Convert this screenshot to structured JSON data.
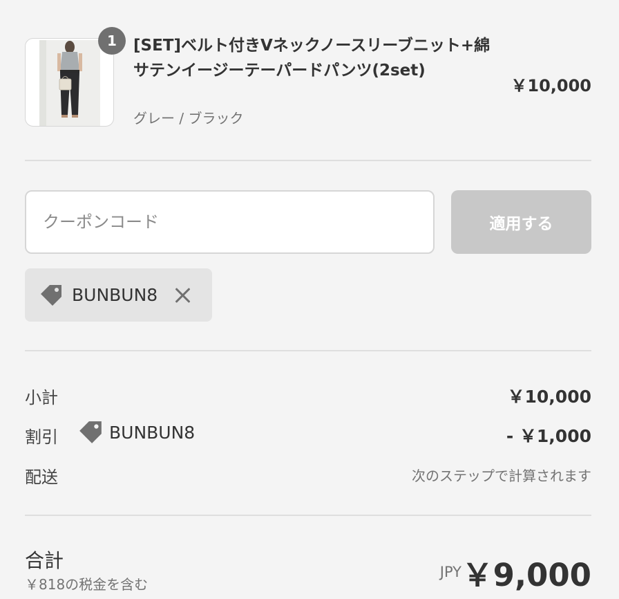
{
  "product": {
    "quantity_badge": "1",
    "title": "[SET]ベルト付きVネックノースリーブニット+綿サテンイージーテーパードパンツ(2set)",
    "variant": "グレー / ブラック",
    "price": "￥10,000"
  },
  "coupon": {
    "placeholder": "クーポンコード",
    "apply_label": "適用する",
    "applied_code": "BUNBUN8"
  },
  "summary": {
    "subtotal_label": "小計",
    "subtotal_value": "￥10,000",
    "discount_label": "割引",
    "discount_code": "BUNBUN8",
    "discount_value": "- ￥1,000",
    "shipping_label": "配送",
    "shipping_value": "次のステップで計算されます"
  },
  "total": {
    "label": "合計",
    "tax_note": "￥818の税金を含む",
    "currency": "JPY",
    "amount": "￥9,000"
  },
  "colors": {
    "background": "#f4f4f4",
    "chip_background": "#e4e4e4",
    "apply_button_disabled": "#c8c8c8",
    "badge": "#707070"
  },
  "icons": {
    "tag": "tag-icon",
    "remove": "close-icon"
  }
}
